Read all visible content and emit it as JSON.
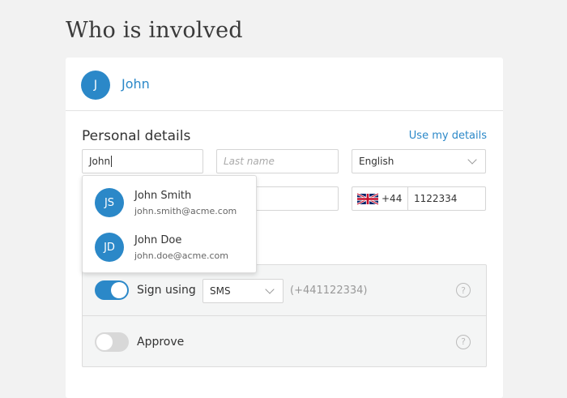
{
  "page": {
    "title": "Who is involved"
  },
  "participant": {
    "initial": "J",
    "name": "John"
  },
  "personal": {
    "title": "Personal details",
    "use_my_details": "Use my details",
    "first_name_value": "John",
    "last_name_placeholder": "Last name",
    "language_value": "English",
    "phone_prefix": "+44",
    "phone_number": "1122334"
  },
  "suggestions": [
    {
      "initials": "JS",
      "name": "John Smith",
      "email": "john.smith@acme.com"
    },
    {
      "initials": "JD",
      "name": "John Doe",
      "email": "john.doe@acme.com"
    }
  ],
  "signing": {
    "sign_label": "Sign using",
    "method_value": "SMS",
    "phone_display": "(+441122334)",
    "approve_label": "Approve",
    "sign_toggle_on": true,
    "approve_toggle_on": false
  },
  "colors": {
    "accent": "#2b88c8"
  },
  "icons": {
    "help": "?"
  }
}
